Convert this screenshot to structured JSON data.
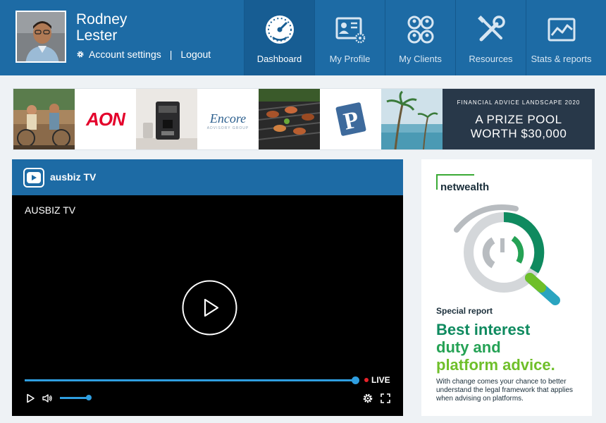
{
  "user": {
    "first_name": "Rodney",
    "last_name": "Lester",
    "account_settings_label": "Account settings",
    "separator": "|",
    "logout_label": "Logout"
  },
  "nav": {
    "items": [
      {
        "label": "Dashboard",
        "icon": "dashboard-gauge-icon",
        "active": true
      },
      {
        "label": "My Profile",
        "icon": "profile-card-icon",
        "active": false
      },
      {
        "label": "My Clients",
        "icon": "clients-group-icon",
        "active": false
      },
      {
        "label": "Resources",
        "icon": "tools-icon",
        "active": false
      },
      {
        "label": "Stats & reports",
        "icon": "chart-image-icon",
        "active": false
      }
    ]
  },
  "banner": {
    "aon_text": "AON",
    "encore_text": "Encore",
    "encore_sub": "ADVISORY GROUP",
    "promo_small": "FINANCIAL ADVICE LANDSCAPE 2020",
    "promo_line1": "A PRIZE POOL",
    "promo_line2": "WORTH $30,000"
  },
  "video": {
    "channel_name": "ausbiz TV",
    "video_title": "AUSBIZ TV",
    "live_label": "LIVE",
    "progress": 1.0,
    "volume": 0.9
  },
  "ad": {
    "brand": "netwealth",
    "kicker": "Special report",
    "headline_1": "Best interest",
    "headline_2": "duty and",
    "headline_3": "platform advice.",
    "body": "With change comes your chance to better understand the legal framework that applies when advising on platforms."
  },
  "colors": {
    "header_blue": "#1d6ba5",
    "accent_blue": "#2f9ee0",
    "live_red": "#e8232a",
    "ad_green_dark": "#0f8a5f",
    "ad_green_light": "#6fbf2a"
  }
}
